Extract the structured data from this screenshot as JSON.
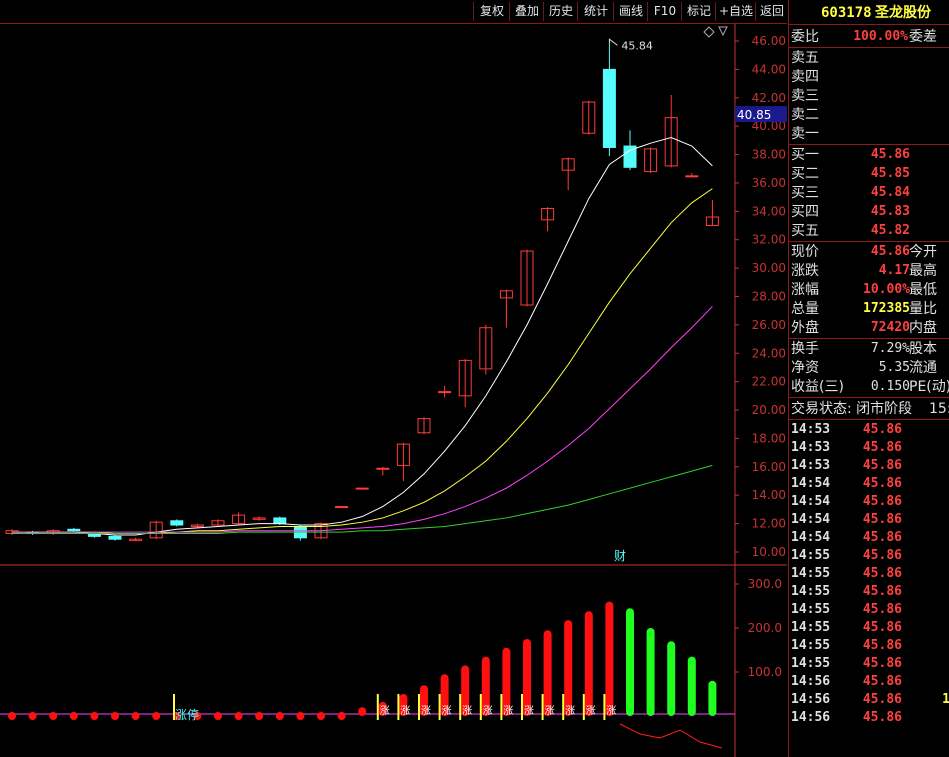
{
  "toolbar": {
    "buttons": [
      "复权",
      "叠加",
      "历史",
      "统计",
      "画线",
      "F10",
      "标记",
      "+自选",
      "返回"
    ]
  },
  "chart": {
    "price_axis": [
      "46.00",
      "44.00",
      "42.00",
      "40.00",
      "38.00",
      "36.00",
      "34.00",
      "32.00",
      "30.00",
      "28.00",
      "26.00",
      "24.00",
      "22.00",
      "20.00",
      "18.00",
      "16.00",
      "14.00",
      "12.00",
      "10.00"
    ],
    "current_price_label": "40.85",
    "high_label": "45.84",
    "finance_marker": "财",
    "volume_axis": [
      "300.0",
      "200.0",
      "100.0"
    ],
    "limit_up_label": "涨停",
    "zhang_label": "涨"
  },
  "chart_data": {
    "type": "candlestick",
    "candles": [
      {
        "o": 11.3,
        "c": 11.5,
        "h": 11.6,
        "l": 11.2
      },
      {
        "o": 11.4,
        "c": 11.3,
        "h": 11.5,
        "l": 11.2
      },
      {
        "o": 11.3,
        "c": 11.5,
        "h": 11.6,
        "l": 11.2
      },
      {
        "o": 11.6,
        "c": 11.5,
        "h": 11.7,
        "l": 11.4
      },
      {
        "o": 11.3,
        "c": 11.1,
        "h": 11.4,
        "l": 11.0
      },
      {
        "o": 11.1,
        "c": 10.9,
        "h": 11.2,
        "l": 10.8
      },
      {
        "o": 10.8,
        "c": 10.9,
        "h": 11.0,
        "l": 10.8
      },
      {
        "o": 11.0,
        "c": 12.1,
        "h": 12.2,
        "l": 10.9
      },
      {
        "o": 12.2,
        "c": 11.9,
        "h": 12.3,
        "l": 11.8
      },
      {
        "o": 11.8,
        "c": 11.9,
        "h": 12.0,
        "l": 11.7
      },
      {
        "o": 11.9,
        "c": 12.2,
        "h": 12.3,
        "l": 11.8
      },
      {
        "o": 12.0,
        "c": 12.6,
        "h": 12.8,
        "l": 11.9
      },
      {
        "o": 12.3,
        "c": 12.4,
        "h": 12.5,
        "l": 12.2
      },
      {
        "o": 12.4,
        "c": 12.0,
        "h": 12.5,
        "l": 11.9
      },
      {
        "o": 11.8,
        "c": 11.0,
        "h": 11.9,
        "l": 10.8
      },
      {
        "o": 11.0,
        "c": 12.0,
        "h": 12.1,
        "l": 10.9
      },
      {
        "o": 13.2,
        "c": 13.2,
        "h": 13.2,
        "l": 13.2
      },
      {
        "o": 14.5,
        "c": 14.5,
        "h": 14.5,
        "l": 14.5
      },
      {
        "o": 15.9,
        "c": 15.9,
        "h": 16.0,
        "l": 15.4
      },
      {
        "o": 16.1,
        "c": 17.6,
        "h": 17.7,
        "l": 15.0
      },
      {
        "o": 18.4,
        "c": 19.4,
        "h": 19.5,
        "l": 18.3
      },
      {
        "o": 21.3,
        "c": 21.3,
        "h": 21.7,
        "l": 20.9
      },
      {
        "o": 21.0,
        "c": 23.5,
        "h": 23.6,
        "l": 20.2
      },
      {
        "o": 22.9,
        "c": 25.8,
        "h": 26.0,
        "l": 22.5
      },
      {
        "o": 27.9,
        "c": 28.4,
        "h": 28.5,
        "l": 25.8
      },
      {
        "o": 27.4,
        "c": 31.2,
        "h": 31.3,
        "l": 27.3
      },
      {
        "o": 33.4,
        "c": 34.2,
        "h": 34.3,
        "l": 32.6
      },
      {
        "o": 36.9,
        "c": 37.7,
        "h": 37.8,
        "l": 35.5
      },
      {
        "o": 39.5,
        "c": 41.7,
        "h": 41.8,
        "l": 39.4
      },
      {
        "o": 44.0,
        "c": 38.5,
        "h": 45.84,
        "l": 37.9
      },
      {
        "o": 38.6,
        "c": 37.1,
        "h": 39.7,
        "l": 36.9
      },
      {
        "o": 36.8,
        "c": 38.4,
        "h": 38.5,
        "l": 36.7
      },
      {
        "o": 37.2,
        "c": 40.6,
        "h": 42.2,
        "l": 37.1
      },
      {
        "o": 36.5,
        "c": 36.5,
        "h": 36.7,
        "l": 36.4
      },
      {
        "o": 33.0,
        "c": 33.6,
        "h": 34.8,
        "l": 33.0
      }
    ],
    "ma_white": [
      11.4,
      11.4,
      11.4,
      11.4,
      11.3,
      11.2,
      11.2,
      11.4,
      11.6,
      11.7,
      11.8,
      11.9,
      12.0,
      12.0,
      11.9,
      11.9,
      12.1,
      12.5,
      13.2,
      14.2,
      15.5,
      17.1,
      18.9,
      21.0,
      23.4,
      26.0,
      28.9,
      31.9,
      34.9,
      37.3,
      38.3,
      38.8,
      39.2,
      38.6,
      37.2
    ],
    "ma_yellow": [
      11.4,
      11.4,
      11.4,
      11.4,
      11.4,
      11.3,
      11.3,
      11.3,
      11.4,
      11.5,
      11.5,
      11.6,
      11.7,
      11.8,
      11.8,
      11.8,
      11.9,
      12.1,
      12.4,
      12.9,
      13.5,
      14.3,
      15.3,
      16.4,
      17.8,
      19.4,
      21.2,
      23.2,
      25.4,
      27.6,
      29.6,
      31.4,
      33.2,
      34.6,
      35.6
    ],
    "ma_magenta": [
      11.4,
      11.4,
      11.4,
      11.4,
      11.4,
      11.4,
      11.4,
      11.4,
      11.4,
      11.4,
      11.4,
      11.5,
      11.5,
      11.5,
      11.5,
      11.5,
      11.6,
      11.7,
      11.8,
      12.0,
      12.3,
      12.7,
      13.2,
      13.8,
      14.5,
      15.4,
      16.4,
      17.5,
      18.7,
      20.1,
      21.5,
      22.9,
      24.4,
      25.8,
      27.3
    ],
    "ma_green": [
      11.3,
      11.3,
      11.3,
      11.3,
      11.3,
      11.3,
      11.3,
      11.3,
      11.3,
      11.3,
      11.3,
      11.4,
      11.4,
      11.4,
      11.4,
      11.4,
      11.4,
      11.5,
      11.5,
      11.6,
      11.7,
      11.8,
      12.0,
      12.2,
      12.4,
      12.7,
      13.0,
      13.3,
      13.7,
      14.1,
      14.5,
      14.9,
      15.3,
      15.7,
      16.1
    ],
    "osc": [
      8,
      8,
      8,
      8,
      8,
      6,
      6,
      8,
      8,
      8,
      10,
      12,
      12,
      10,
      6,
      8,
      10,
      20,
      32,
      50,
      70,
      95,
      115,
      135,
      155,
      175,
      195,
      218,
      238,
      260,
      245,
      200,
      170,
      135,
      80,
      25
    ]
  },
  "panel": {
    "stock_code": "603178",
    "stock_name": "圣龙股份",
    "weibi_label": "委比",
    "weibi_value": "100.00%",
    "weicha_label": "委差",
    "asks": [
      "卖五",
      "卖四",
      "卖三",
      "卖二",
      "卖一"
    ],
    "bids": [
      {
        "label": "买一",
        "value": "45.86"
      },
      {
        "label": "买二",
        "value": "45.85"
      },
      {
        "label": "买三",
        "value": "45.84"
      },
      {
        "label": "买四",
        "value": "45.83"
      },
      {
        "label": "买五",
        "value": "45.82"
      }
    ],
    "quote": [
      {
        "label": "现价",
        "value": "45.86",
        "label2": "今开",
        "color": "#ff4040"
      },
      {
        "label": "涨跌",
        "value": "4.17",
        "label2": "最高",
        "color": "#ff4040"
      },
      {
        "label": "涨幅",
        "value": "10.00%",
        "label2": "最低",
        "color": "#ff4040"
      },
      {
        "label": "总量",
        "value": "172385",
        "label2": "量比",
        "color": "#ffff40"
      },
      {
        "label": "外盘",
        "value": "72420",
        "label2": "内盘",
        "color": "#ff4040"
      }
    ],
    "fin": [
      {
        "label": "换手",
        "value": "7.29%",
        "label2": "股本"
      },
      {
        "label": "净资",
        "value": "5.35",
        "label2": "流通"
      },
      {
        "label": "收益(三)",
        "value": "0.150",
        "label2": "PE(动)"
      }
    ],
    "status": "交易状态: 闭市阶段",
    "status_tail": "15:",
    "ticks": [
      {
        "t": "14:53",
        "p": "45.86"
      },
      {
        "t": "14:53",
        "p": "45.86"
      },
      {
        "t": "14:53",
        "p": "45.86"
      },
      {
        "t": "14:54",
        "p": "45.86"
      },
      {
        "t": "14:54",
        "p": "45.86"
      },
      {
        "t": "14:54",
        "p": "45.86"
      },
      {
        "t": "14:54",
        "p": "45.86"
      },
      {
        "t": "14:55",
        "p": "45.86"
      },
      {
        "t": "14:55",
        "p": "45.86"
      },
      {
        "t": "14:55",
        "p": "45.86"
      },
      {
        "t": "14:55",
        "p": "45.86"
      },
      {
        "t": "14:55",
        "p": "45.86"
      },
      {
        "t": "14:55",
        "p": "45.86"
      },
      {
        "t": "14:55",
        "p": "45.86"
      },
      {
        "t": "14:56",
        "p": "45.86"
      },
      {
        "t": "14:56",
        "p": "45.86"
      },
      {
        "t": "14:56",
        "p": "45.86"
      }
    ],
    "tick_extra": "1"
  },
  "colors": {
    "up": "#ff3b3b",
    "down": "#54fcfc",
    "border": "#8b1a1a",
    "axis": "#c83232"
  }
}
